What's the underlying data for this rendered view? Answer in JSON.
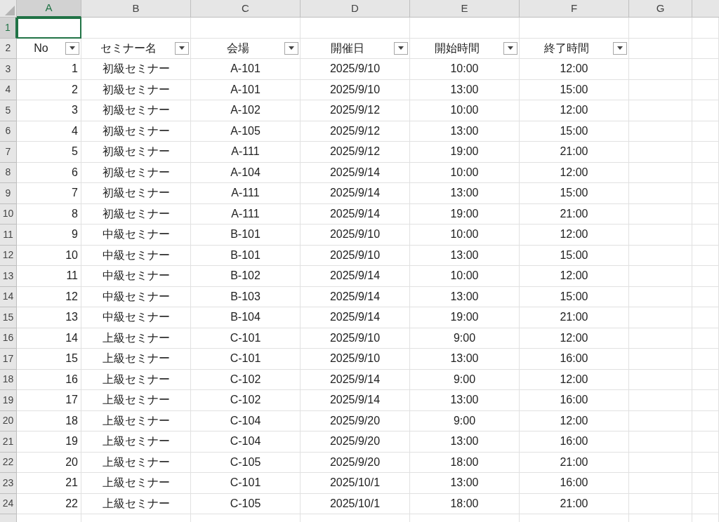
{
  "columns": [
    {
      "label": "A",
      "selected": true
    },
    {
      "label": "B",
      "selected": false
    },
    {
      "label": "C",
      "selected": false
    },
    {
      "label": "D",
      "selected": false
    },
    {
      "label": "E",
      "selected": false
    },
    {
      "label": "F",
      "selected": false
    },
    {
      "label": "G",
      "selected": false
    }
  ],
  "rows": [
    {
      "number": "1",
      "selected": true,
      "cells": [
        {
          "active": true
        }
      ]
    },
    {
      "number": "2",
      "selected": false,
      "cells": [
        {
          "text": "No",
          "filter": true
        },
        {
          "text": "セミナー名",
          "filter": true
        },
        {
          "text": "会場",
          "filter": true
        },
        {
          "text": "開催日",
          "filter": true
        },
        {
          "text": "開始時間",
          "filter": true
        },
        {
          "text": "終了時間",
          "filter": true
        }
      ]
    },
    {
      "number": "3",
      "selected": false,
      "cells": [
        {
          "text": "1"
        },
        {
          "text": "初級セミナー"
        },
        {
          "text": "A-101"
        },
        {
          "text": "2025/9/10"
        },
        {
          "text": "10:00"
        },
        {
          "text": "12:00"
        }
      ]
    },
    {
      "number": "4",
      "selected": false,
      "cells": [
        {
          "text": "2"
        },
        {
          "text": "初級セミナー"
        },
        {
          "text": "A-101"
        },
        {
          "text": "2025/9/10"
        },
        {
          "text": "13:00"
        },
        {
          "text": "15:00"
        }
      ]
    },
    {
      "number": "5",
      "selected": false,
      "cells": [
        {
          "text": "3"
        },
        {
          "text": "初級セミナー"
        },
        {
          "text": "A-102"
        },
        {
          "text": "2025/9/12"
        },
        {
          "text": "10:00"
        },
        {
          "text": "12:00"
        }
      ]
    },
    {
      "number": "6",
      "selected": false,
      "cells": [
        {
          "text": "4"
        },
        {
          "text": "初級セミナー"
        },
        {
          "text": "A-105"
        },
        {
          "text": "2025/9/12"
        },
        {
          "text": "13:00"
        },
        {
          "text": "15:00"
        }
      ]
    },
    {
      "number": "7",
      "selected": false,
      "cells": [
        {
          "text": "5"
        },
        {
          "text": "初級セミナー"
        },
        {
          "text": "A-111"
        },
        {
          "text": "2025/9/12"
        },
        {
          "text": "19:00"
        },
        {
          "text": "21:00"
        }
      ]
    },
    {
      "number": "8",
      "selected": false,
      "cells": [
        {
          "text": "6"
        },
        {
          "text": "初級セミナー"
        },
        {
          "text": "A-104"
        },
        {
          "text": "2025/9/14"
        },
        {
          "text": "10:00"
        },
        {
          "text": "12:00"
        }
      ]
    },
    {
      "number": "9",
      "selected": false,
      "cells": [
        {
          "text": "7"
        },
        {
          "text": "初級セミナー"
        },
        {
          "text": "A-111"
        },
        {
          "text": "2025/9/14"
        },
        {
          "text": "13:00"
        },
        {
          "text": "15:00"
        }
      ]
    },
    {
      "number": "10",
      "selected": false,
      "cells": [
        {
          "text": "8"
        },
        {
          "text": "初級セミナー"
        },
        {
          "text": "A-111"
        },
        {
          "text": "2025/9/14"
        },
        {
          "text": "19:00"
        },
        {
          "text": "21:00"
        }
      ]
    },
    {
      "number": "11",
      "selected": false,
      "cells": [
        {
          "text": "9"
        },
        {
          "text": "中級セミナー"
        },
        {
          "text": "B-101"
        },
        {
          "text": "2025/9/10"
        },
        {
          "text": "10:00"
        },
        {
          "text": "12:00"
        }
      ]
    },
    {
      "number": "12",
      "selected": false,
      "cells": [
        {
          "text": "10"
        },
        {
          "text": "中級セミナー"
        },
        {
          "text": "B-101"
        },
        {
          "text": "2025/9/10"
        },
        {
          "text": "13:00"
        },
        {
          "text": "15:00"
        }
      ]
    },
    {
      "number": "13",
      "selected": false,
      "cells": [
        {
          "text": "11"
        },
        {
          "text": "中級セミナー"
        },
        {
          "text": "B-102"
        },
        {
          "text": "2025/9/14"
        },
        {
          "text": "10:00"
        },
        {
          "text": "12:00"
        }
      ]
    },
    {
      "number": "14",
      "selected": false,
      "cells": [
        {
          "text": "12"
        },
        {
          "text": "中級セミナー"
        },
        {
          "text": "B-103"
        },
        {
          "text": "2025/9/14"
        },
        {
          "text": "13:00"
        },
        {
          "text": "15:00"
        }
      ]
    },
    {
      "number": "15",
      "selected": false,
      "cells": [
        {
          "text": "13"
        },
        {
          "text": "中級セミナー"
        },
        {
          "text": "B-104"
        },
        {
          "text": "2025/9/14"
        },
        {
          "text": "19:00"
        },
        {
          "text": "21:00"
        }
      ]
    },
    {
      "number": "16",
      "selected": false,
      "cells": [
        {
          "text": "14"
        },
        {
          "text": "上級セミナー"
        },
        {
          "text": "C-101"
        },
        {
          "text": "2025/9/10"
        },
        {
          "text": "9:00"
        },
        {
          "text": "12:00"
        }
      ]
    },
    {
      "number": "17",
      "selected": false,
      "cells": [
        {
          "text": "15"
        },
        {
          "text": "上級セミナー"
        },
        {
          "text": "C-101"
        },
        {
          "text": "2025/9/10"
        },
        {
          "text": "13:00"
        },
        {
          "text": "16:00"
        }
      ]
    },
    {
      "number": "18",
      "selected": false,
      "cells": [
        {
          "text": "16"
        },
        {
          "text": "上級セミナー"
        },
        {
          "text": "C-102"
        },
        {
          "text": "2025/9/14"
        },
        {
          "text": "9:00"
        },
        {
          "text": "12:00"
        }
      ]
    },
    {
      "number": "19",
      "selected": false,
      "cells": [
        {
          "text": "17"
        },
        {
          "text": "上級セミナー"
        },
        {
          "text": "C-102"
        },
        {
          "text": "2025/9/14"
        },
        {
          "text": "13:00"
        },
        {
          "text": "16:00"
        }
      ]
    },
    {
      "number": "20",
      "selected": false,
      "cells": [
        {
          "text": "18"
        },
        {
          "text": "上級セミナー"
        },
        {
          "text": "C-104"
        },
        {
          "text": "2025/9/20"
        },
        {
          "text": "9:00"
        },
        {
          "text": "12:00"
        }
      ]
    },
    {
      "number": "21",
      "selected": false,
      "cells": [
        {
          "text": "19"
        },
        {
          "text": "上級セミナー"
        },
        {
          "text": "C-104"
        },
        {
          "text": "2025/9/20"
        },
        {
          "text": "13:00"
        },
        {
          "text": "16:00"
        }
      ]
    },
    {
      "number": "22",
      "selected": false,
      "cells": [
        {
          "text": "20"
        },
        {
          "text": "上級セミナー"
        },
        {
          "text": "C-105"
        },
        {
          "text": "2025/9/20"
        },
        {
          "text": "18:00"
        },
        {
          "text": "21:00"
        }
      ]
    },
    {
      "number": "23",
      "selected": false,
      "cells": [
        {
          "text": "21"
        },
        {
          "text": "上級セミナー"
        },
        {
          "text": "C-101"
        },
        {
          "text": "2025/10/1"
        },
        {
          "text": "13:00"
        },
        {
          "text": "16:00"
        }
      ]
    },
    {
      "number": "24",
      "selected": false,
      "cells": [
        {
          "text": "22"
        },
        {
          "text": "上級セミナー"
        },
        {
          "text": "C-105"
        },
        {
          "text": "2025/10/1"
        },
        {
          "text": "18:00"
        },
        {
          "text": "21:00"
        }
      ]
    }
  ]
}
